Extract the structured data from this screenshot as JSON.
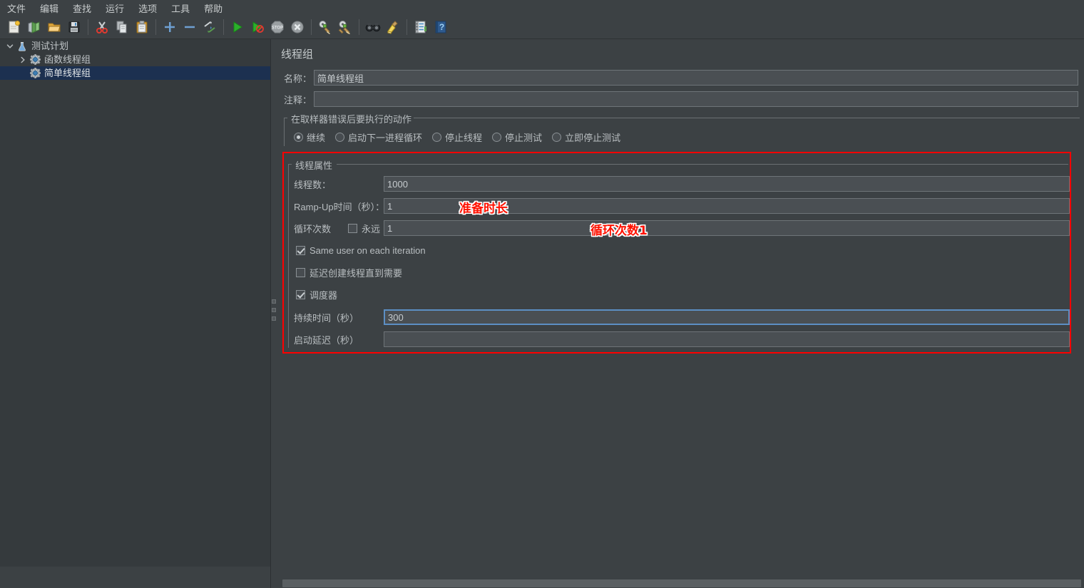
{
  "menu": {
    "items": [
      {
        "name": "file",
        "label": "文件"
      },
      {
        "name": "edit",
        "label": "编辑"
      },
      {
        "name": "search",
        "label": "查找"
      },
      {
        "name": "run",
        "label": "运行"
      },
      {
        "name": "options",
        "label": "选项"
      },
      {
        "name": "tools",
        "label": "工具"
      },
      {
        "name": "help",
        "label": "帮助"
      }
    ]
  },
  "toolbar": {
    "buttons": [
      {
        "name": "new-icon",
        "title": "新建"
      },
      {
        "name": "templates-icon",
        "title": "模板"
      },
      {
        "name": "open-icon",
        "title": "打开"
      },
      {
        "name": "save-icon",
        "title": "保存"
      },
      {
        "name": "cut-icon",
        "title": "剪切"
      },
      {
        "name": "copy-icon",
        "title": "复制"
      },
      {
        "name": "paste-icon",
        "title": "粘贴"
      },
      {
        "name": "expand-all-icon",
        "title": "展开全部"
      },
      {
        "name": "collapse-all-icon",
        "title": "折叠全部"
      },
      {
        "name": "toggle-icon",
        "title": "启用/禁用"
      },
      {
        "name": "start-icon",
        "title": "启动"
      },
      {
        "name": "start-no-pause-icon",
        "title": "无暂停启动"
      },
      {
        "name": "stop-icon",
        "title": "停止"
      },
      {
        "name": "shutdown-icon",
        "title": "关闭"
      },
      {
        "name": "clear-icon",
        "title": "清除"
      },
      {
        "name": "clear-all-icon",
        "title": "清除全部"
      },
      {
        "name": "search-icon",
        "title": "查找"
      },
      {
        "name": "search-reset-icon",
        "title": "重置查找"
      },
      {
        "name": "function-helper-icon",
        "title": "函数助手对话框"
      },
      {
        "name": "help-icon",
        "title": "帮助"
      }
    ]
  },
  "tree": {
    "nodes": [
      {
        "name": "test-plan",
        "label": "测试计划",
        "icon": "test-plan-icon",
        "indent": 0,
        "toggle": "expanded",
        "selected": false
      },
      {
        "name": "thread-group-1",
        "label": "函数线程组",
        "icon": "thread-group-icon",
        "indent": 1,
        "toggle": "collapsed",
        "selected": false
      },
      {
        "name": "thread-group-2",
        "label": "简单线程组",
        "icon": "thread-group-icon",
        "indent": 1,
        "toggle": "none",
        "selected": true
      }
    ]
  },
  "detail": {
    "title": "线程组",
    "name_label": "名称：",
    "name_value": "简单线程组",
    "comment_label": "注释：",
    "comment_value": "",
    "error_action": {
      "group_title": "在取样器错误后要执行的动作",
      "options": [
        {
          "name": "continue",
          "label": "继续",
          "selected": true
        },
        {
          "name": "start-next-loop",
          "label": "启动下一进程循环",
          "selected": false
        },
        {
          "name": "stop-thread",
          "label": "停止线程",
          "selected": false
        },
        {
          "name": "stop-test",
          "label": "停止测试",
          "selected": false
        },
        {
          "name": "stop-test-now",
          "label": "立即停止测试",
          "selected": false
        }
      ]
    },
    "thread_props": {
      "group_title": "线程属性",
      "threads_label": "线程数：",
      "threads_value": "1000",
      "rampup_label": "Ramp-Up时间（秒）：",
      "rampup_value": "1",
      "loops_label": "循环次数",
      "forever_label": "永远",
      "forever_checked": false,
      "loops_value": "1",
      "same_user_label": "Same user on each iteration",
      "same_user_checked": true,
      "delayed_start_label": "延迟创建线程直到需要",
      "delayed_start_checked": false,
      "scheduler_label": "调度器",
      "scheduler_checked": true,
      "duration_label": "持续时间（秒）",
      "duration_value": "300",
      "startup_delay_label": "启动延迟（秒）",
      "startup_delay_value": ""
    }
  },
  "annotations": [
    {
      "name": "annotation-rampup",
      "text": "准备时长",
      "color": "#ff1100"
    },
    {
      "name": "annotation-loops",
      "text": "循环次数1",
      "color": "#ff1100"
    }
  ],
  "colors": {
    "window_bg": "#3c4144",
    "tree_bg": "#353a3d",
    "selection": "#1c3050",
    "input_bg": "#4a4f53",
    "focus_border": "#5c8fc4",
    "annotation_red": "#fe0000"
  }
}
